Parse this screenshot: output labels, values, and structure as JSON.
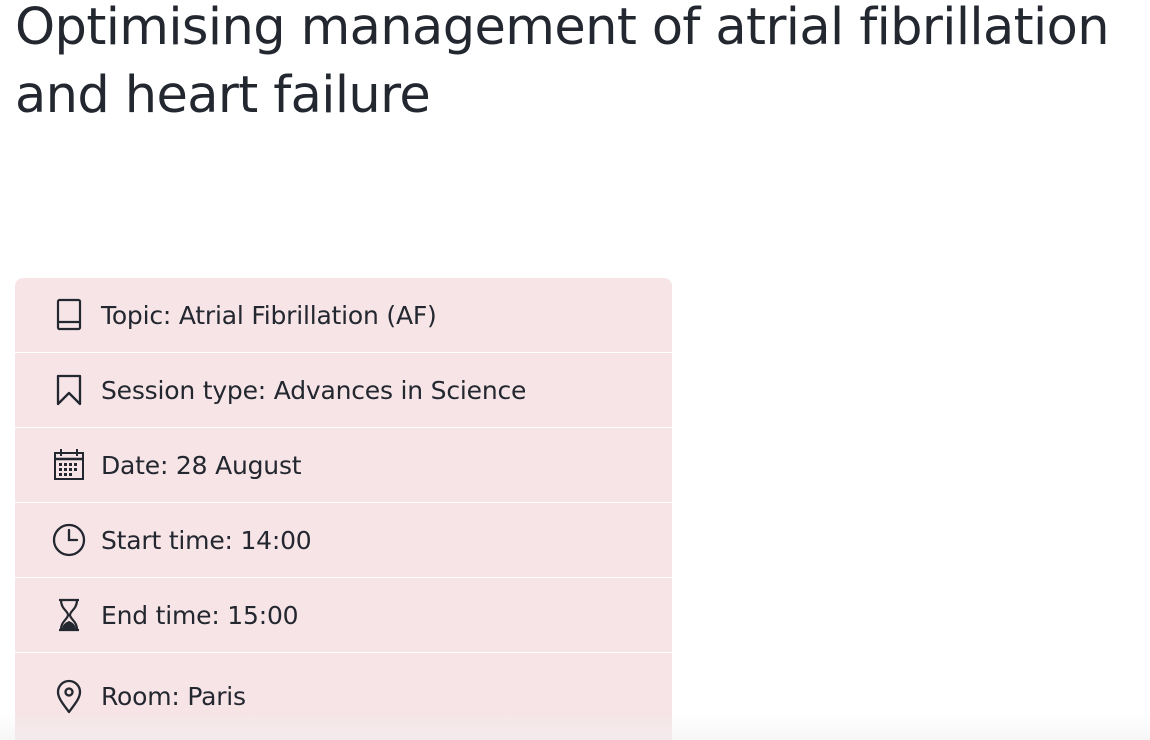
{
  "session": {
    "title": "Optimising management of atrial fibrillation and heart failure"
  },
  "details": [
    {
      "icon": "book-icon",
      "label": "Topic: Atrial Fibrillation (AF)"
    },
    {
      "icon": "bookmark-icon",
      "label": "Session type: Advances in Science"
    },
    {
      "icon": "calendar-icon",
      "label": "Date: 28 August"
    },
    {
      "icon": "clock-icon",
      "label": "Start time: 14:00"
    },
    {
      "icon": "hourglass-icon",
      "label": "End time: 15:00"
    },
    {
      "icon": "location-pin-icon",
      "label": "Room: Paris"
    }
  ],
  "colors": {
    "card_background": "#f6e4e6",
    "text": "#23272f",
    "divider": "#ffffff"
  }
}
